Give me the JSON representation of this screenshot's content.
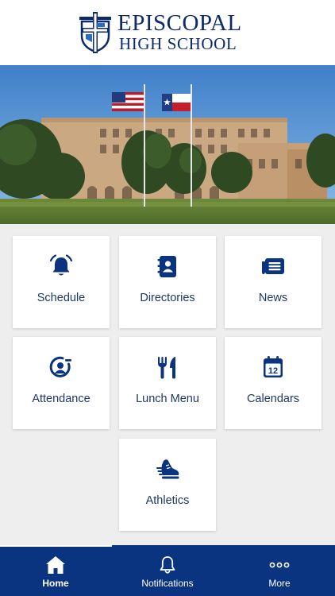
{
  "header": {
    "line1": "EPISCOPAL",
    "line2": "HIGH SCHOOL",
    "brand_color": "#0d2a6b",
    "logo_icon": "school-crest-icon"
  },
  "hero": {
    "photo": "school-building-with-flags"
  },
  "tiles": [
    {
      "label": "Schedule",
      "icon": "bell-icon"
    },
    {
      "label": "Directories",
      "icon": "contact-book-icon"
    },
    {
      "label": "News",
      "icon": "newspaper-icon"
    },
    {
      "label": "Attendance",
      "icon": "attendance-icon"
    },
    {
      "label": "Lunch Menu",
      "icon": "fork-knife-icon"
    },
    {
      "label": "Calendars",
      "icon": "calendar-icon",
      "calendar_day": "12"
    },
    {
      "label": "Athletics",
      "icon": "sneaker-icon"
    }
  ],
  "tabbar": {
    "background": "#0b3480",
    "items": [
      {
        "label": "Home",
        "icon": "home-icon",
        "active": true
      },
      {
        "label": "Notifications",
        "icon": "bell-outline-icon",
        "active": false
      },
      {
        "label": "More",
        "icon": "more-dots-icon",
        "active": false
      }
    ]
  }
}
